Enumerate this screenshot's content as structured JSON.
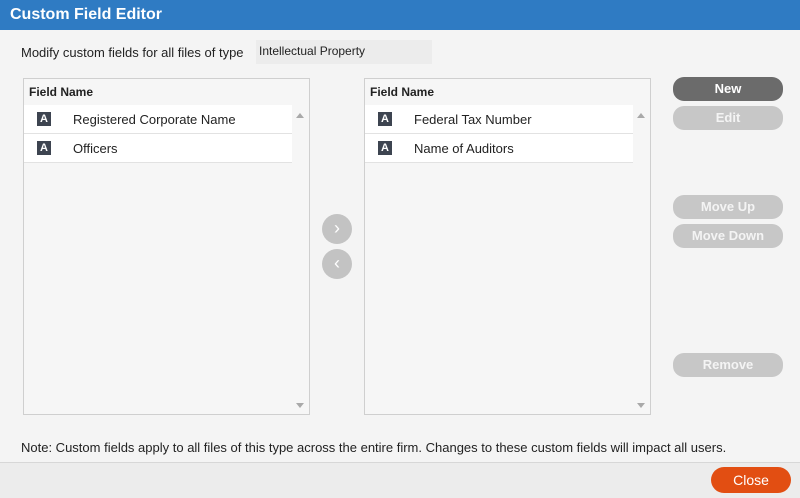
{
  "window": {
    "title": "Custom Field Editor"
  },
  "type_selector": {
    "label": "Modify custom fields for all files of type",
    "value": "Intellectual Property"
  },
  "available_list": {
    "header": "Field Name",
    "rows": [
      {
        "icon": "A",
        "label": "Registered Corporate Name"
      },
      {
        "icon": "A",
        "label": "Officers"
      }
    ]
  },
  "selected_list": {
    "header": "Field Name",
    "rows": [
      {
        "icon": "A",
        "label": "Federal Tax Number"
      },
      {
        "icon": "A",
        "label": "Name of Auditors"
      }
    ]
  },
  "transfer": {
    "add_glyph": "›",
    "remove_glyph": "‹"
  },
  "buttons": {
    "new": "New",
    "edit": "Edit",
    "move_up": "Move Up",
    "move_down": "Move Down",
    "remove": "Remove"
  },
  "note": "Note: Custom fields apply to all files of this type across the entire firm. Changes to these custom fields will impact all users.",
  "footer": {
    "close": "Close"
  },
  "colors": {
    "title_bar": "#2f7bc3",
    "close_button": "#e24e12",
    "primary_button": "#6b6b6b",
    "disabled_button": "#c7c7c7"
  }
}
